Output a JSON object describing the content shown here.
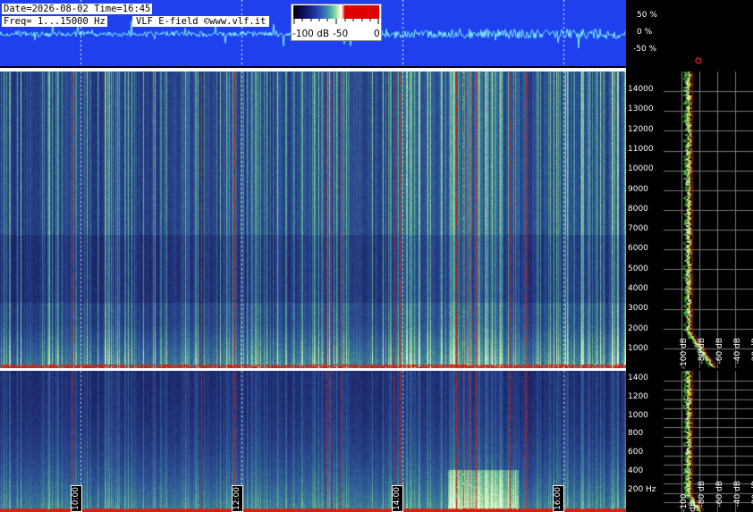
{
  "header": {
    "date_line": "Date=2026-08-02 Time=16:45",
    "freq_line": "Freq= 1...15000 Hz",
    "field_line": "VLF E-field ©www.vlf.it"
  },
  "colorbar": {
    "labels": [
      "-100 dB",
      "-50",
      "0"
    ]
  },
  "waveform_axis": [
    "50 %",
    "0 %",
    "-50 %"
  ],
  "upper_freq_axis": [
    "14000",
    "13000",
    "12000",
    "11000",
    "10000",
    "9000",
    "8000",
    "7000",
    "6000",
    "5000",
    "4000",
    "3000",
    "2000",
    "1000"
  ],
  "lower_freq_axis": [
    "1400",
    "1200",
    "1000",
    "800",
    "600",
    "400",
    "200 Hz"
  ],
  "upper_db_axis": [
    "-100 dB",
    "-80 dB",
    "-60 dB",
    "-40 dB",
    "-20 dB"
  ],
  "lower_db_axis": [
    "-100 dB",
    "-80 dB",
    "-60 dB",
    "-40 dB",
    "-20 dB"
  ],
  "time_labels": [
    "10:00",
    "12:00",
    "14:00",
    "16:00"
  ],
  "colors": {
    "banner_blue": "#1f40ee",
    "waveform": "#7ff0ff",
    "spectrum_low": "#1a2460",
    "spectrum_high": "#a8e0a8",
    "noise_red": "#d82010",
    "marker": "#ff2020"
  }
}
